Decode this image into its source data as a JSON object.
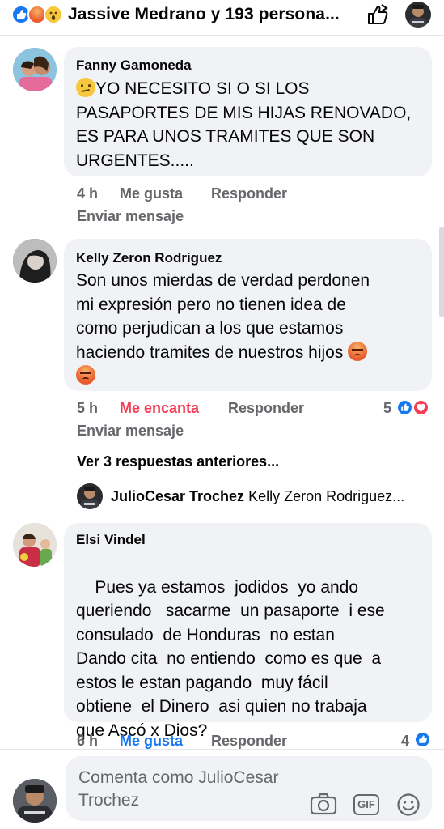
{
  "header": {
    "title": "Jassive Medrano y 193 persona...",
    "reactions": [
      "like-icon",
      "angry-icon",
      "wow-icon"
    ],
    "share_icon": "share-icon"
  },
  "comments": [
    {
      "author": "Fanny Gamoneda",
      "lines": [
        "YO NECESITO SI O SI LOS",
        "PASAPORTES DE MIS HIJAS RENOVADO,",
        "ES PARA UNOS TRAMITES QUE SON",
        "URGENTES....."
      ],
      "leading_emoji": "confused-emoji",
      "time": "4 h",
      "reaction_action": "Me gusta",
      "reply": "Responder",
      "message": "Enviar mensaje"
    },
    {
      "author": "Kelly Zeron Rodriguez",
      "lines": [
        "Son unos mierdas de verdad perdonen",
        "mi expresión pero no tienen idea de",
        "como perjudican a los que estamos",
        "haciendo tramites de nuestros hijos"
      ],
      "trailing_emojis": [
        "angry-emoji",
        "angry-emoji"
      ],
      "time": "5 h",
      "reaction_action": "Me encanta",
      "reply": "Responder",
      "reaction_count": "5",
      "message": "Enviar mensaje",
      "previous_replies": "Ver 3 respuestas anteriores...",
      "latest_reply": {
        "author": "JulioCesar Trochez",
        "text": "Kelly Zeron Rodriguez..."
      }
    },
    {
      "author": "Elsi Vindel",
      "lines": [
        "Pues ya estamos  jodidos  yo ando",
        "queriendo   sacarme  un pasaporte  i ese",
        "consulado  de Honduras  no estan",
        "Dando cita  no entiendo  como es que  a",
        "estos le estan pagando  muy fácil",
        "obtiene  el Dinero  asi quien no trabaja",
        "que Ascó x Dios?"
      ],
      "time": "6 h",
      "reaction_action": "Me gusta",
      "reply": "Responder",
      "reaction_count": "4"
    }
  ],
  "composer": {
    "placeholder": "Comenta como JulioCesar Trochez",
    "tools": [
      "camera-icon",
      "gif-icon",
      "emoji-icon"
    ],
    "gif_label": "GIF"
  },
  "colors": {
    "bubble": "#f0f2f5",
    "meta_gray": "#65676b",
    "like_blue": "#1877f2",
    "love_red": "#f33e58"
  }
}
